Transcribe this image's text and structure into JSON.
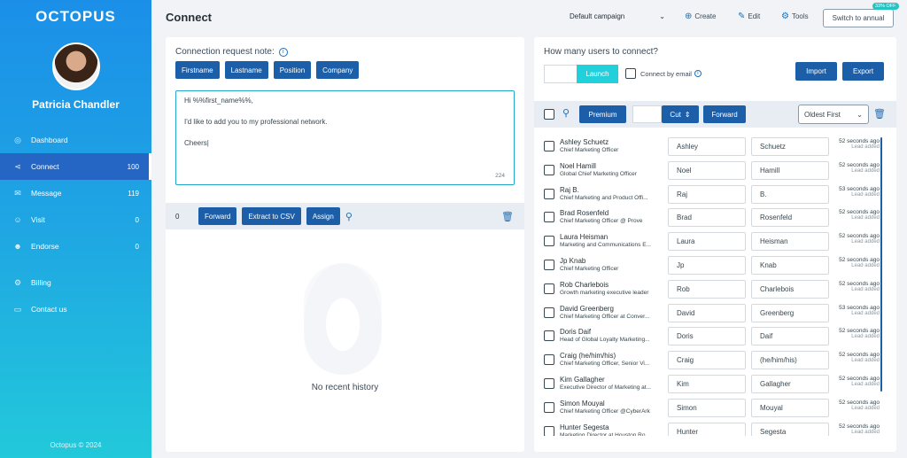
{
  "sidebar": {
    "logo": "OCTOPUS",
    "user_name": "Patricia Chandler",
    "items": [
      {
        "label": "Dashboard",
        "count": ""
      },
      {
        "label": "Connect",
        "count": "100"
      },
      {
        "label": "Message",
        "count": "119"
      },
      {
        "label": "Visit",
        "count": "0"
      },
      {
        "label": "Endorse",
        "count": "0"
      },
      {
        "label": "Billing",
        "count": ""
      },
      {
        "label": "Contact us",
        "count": ""
      }
    ],
    "footer": "Octopus © 2024"
  },
  "header": {
    "title": "Connect",
    "campaign": "Default campaign",
    "create": "Create",
    "edit": "Edit",
    "tools": "Tools",
    "switch": "Switch to annual",
    "badge": "33% OFF"
  },
  "note": {
    "label": "Connection request note:",
    "chips": [
      "Firstname",
      "Lastname",
      "Position",
      "Company"
    ],
    "lines": [
      "Hi %%first_name%%,",
      "I'd like to add you to my professional network.",
      "Cheers|"
    ],
    "char_count": "224"
  },
  "history": {
    "count": "0",
    "forward": "Forward",
    "extract": "Extract to CSV",
    "assign": "Assign",
    "empty": "No recent history"
  },
  "connect": {
    "question": "How many users to connect?",
    "launch": "Launch",
    "connect_by_email": "Connect by email",
    "import": "Import",
    "export": "Export",
    "premium": "Premium",
    "cut": "Cut",
    "forward": "Forward",
    "sort": "Oldest First"
  },
  "users": [
    {
      "name": "Ashley Schuetz",
      "title": "Chief Marketing Officer",
      "first": "Ashley",
      "last": "Schuetz",
      "time": "52 seconds ago",
      "status": "Lead added"
    },
    {
      "name": "Noel Hamill",
      "title": "Global Chief Marketing Officer",
      "first": "Noel",
      "last": "Hamill",
      "time": "52 seconds ago",
      "status": "Lead added"
    },
    {
      "name": "Raj B.",
      "title": "Chief Marketing and Product Offi...",
      "first": "Raj",
      "last": "B.",
      "time": "53 seconds ago",
      "status": "Lead added"
    },
    {
      "name": "Brad Rosenfeld",
      "title": "Chief Marketing Officer @ Prove",
      "first": "Brad",
      "last": "Rosenfeld",
      "time": "52 seconds ago",
      "status": "Lead added"
    },
    {
      "name": "Laura Heisman",
      "title": "Marketing and Communications E...",
      "first": "Laura",
      "last": "Heisman",
      "time": "52 seconds ago",
      "status": "Lead added"
    },
    {
      "name": "Jp Knab",
      "title": "Chief Marketing Officer",
      "first": "Jp",
      "last": "Knab",
      "time": "52 seconds ago",
      "status": "Lead added"
    },
    {
      "name": "Rob Charlebois",
      "title": "Growth marketing executive leader",
      "first": "Rob",
      "last": "Charlebois",
      "time": "52 seconds ago",
      "status": "Lead added"
    },
    {
      "name": "David Greenberg",
      "title": "Chief Marketing Officer at Conver...",
      "first": "David",
      "last": "Greenberg",
      "time": "53 seconds ago",
      "status": "Lead added"
    },
    {
      "name": "Doris Daif",
      "title": "Head of Global Loyalty Marketing...",
      "first": "Doris",
      "last": "Daif",
      "time": "52 seconds ago",
      "status": "Lead added"
    },
    {
      "name": "Craig (he/him/his)",
      "title": "Chief Marketing Officer, Senior Vi...",
      "first": "Craig",
      "last": "(he/him/his)",
      "time": "52 seconds ago",
      "status": "Lead added"
    },
    {
      "name": "Kim Gallagher",
      "title": "Executive Director of Marketing at...",
      "first": "Kim",
      "last": "Gallagher",
      "time": "52 seconds ago",
      "status": "Lead added"
    },
    {
      "name": "Simon Mouyal",
      "title": "Chief Marketing Officer @CyberArk",
      "first": "Simon",
      "last": "Mouyal",
      "time": "52 seconds ago",
      "status": "Lead added"
    },
    {
      "name": "Hunter Segesta",
      "title": "Marketing Director at Houston Ro...",
      "first": "Hunter",
      "last": "Segesta",
      "time": "52 seconds ago",
      "status": "Lead added"
    }
  ]
}
